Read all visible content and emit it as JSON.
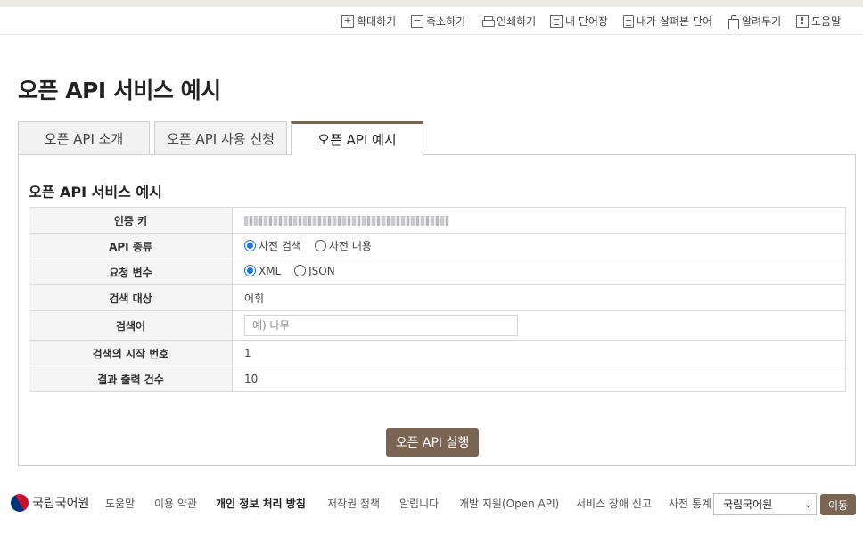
{
  "utility": {
    "zoom_in": "확대하기",
    "zoom_out": "축소하기",
    "print": "인쇄하기",
    "my_wordbook": "내 단어장",
    "viewed_words": "내가 살펴본 단어",
    "notify": "알려두기",
    "help": "도움말"
  },
  "page": {
    "title": "오픈 API 서비스 예시"
  },
  "tabs": [
    {
      "label": "오픈 API 소개"
    },
    {
      "label": "오픈 API 사용 신청"
    },
    {
      "label": "오픈 API 예시"
    }
  ],
  "panel": {
    "section_title": "오픈 API 서비스 예시",
    "rows": {
      "auth_key": {
        "label": "인증 키"
      },
      "api_type": {
        "label": "API 종류",
        "options": [
          "사전 검색",
          "사전 내용"
        ],
        "selected": "사전 검색"
      },
      "request_var": {
        "label": "요청 변수",
        "options": [
          "XML",
          "JSON"
        ],
        "selected": "XML"
      },
      "target": {
        "label": "검색 대상",
        "value": "어휘"
      },
      "query": {
        "label": "검색어",
        "placeholder": "예) 나무"
      },
      "start": {
        "label": "검색의 시작 번호",
        "value": "1"
      },
      "count": {
        "label": "결과 출력 건수",
        "value": "10"
      }
    },
    "run_label": "오픈 API 실행"
  },
  "footer": {
    "logo": "국립국어원",
    "links": [
      "도움말",
      "이용 약관",
      "개인 정보 처리 방침",
      "저작권 정책",
      "알립니다",
      "개발 지원(Open API)",
      "서비스 장애 신고",
      "사전 통계"
    ],
    "select_value": "국립국어원",
    "go_label": "이동"
  },
  "colors": {
    "accent": "#7a6553",
    "radio": "#1a73e8"
  }
}
